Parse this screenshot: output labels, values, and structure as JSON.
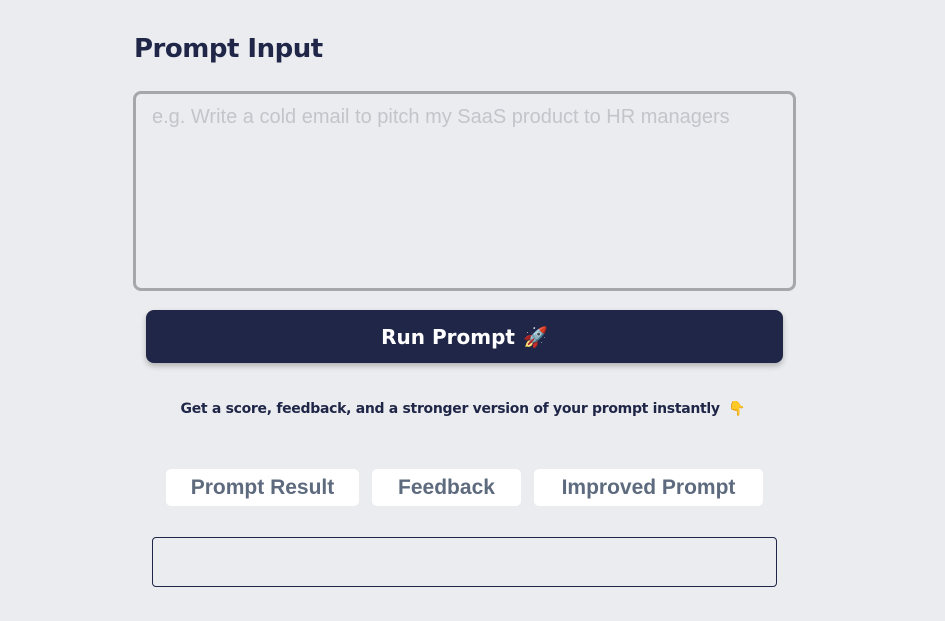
{
  "header": {
    "title": "Prompt Input"
  },
  "prompt": {
    "value": "",
    "placeholder": "e.g. Write a cold email to pitch my SaaS product to HR managers"
  },
  "run_button": {
    "label": "Run Prompt",
    "icon": "🚀"
  },
  "subtitle": {
    "text": "Get a score, feedback, and a stronger version of your prompt instantly",
    "icon": "👇"
  },
  "tabs": [
    {
      "label": "Prompt Result"
    },
    {
      "label": "Feedback"
    },
    {
      "label": "Improved Prompt"
    }
  ],
  "output": {
    "value": ""
  },
  "colors": {
    "background": "#ebecef",
    "primary": "#1f2647",
    "tab_text": "#5e6a7e",
    "border": "#a5a7ab"
  }
}
